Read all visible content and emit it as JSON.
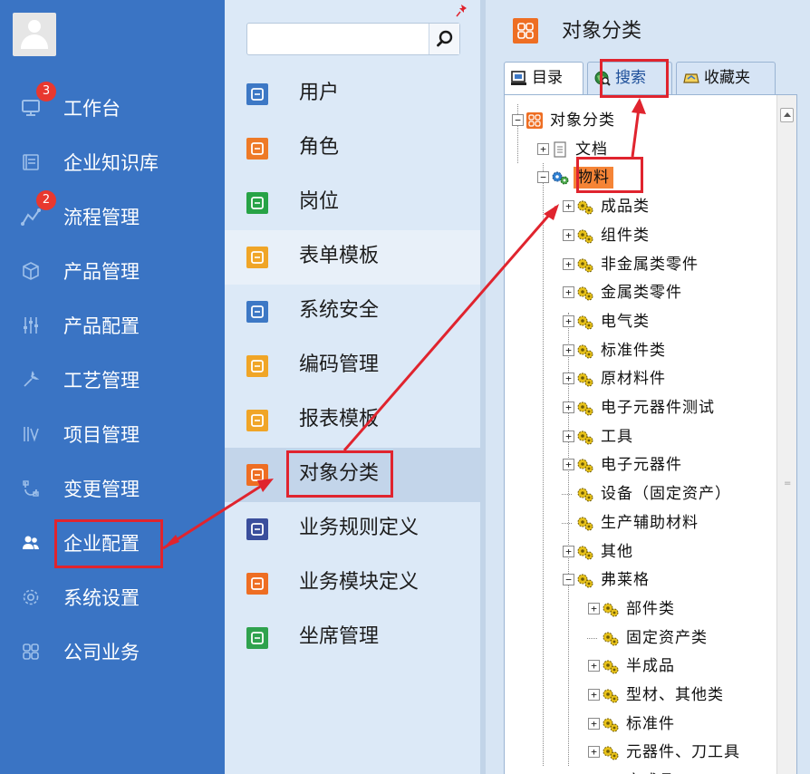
{
  "sidebar": {
    "items": [
      {
        "label": "工作台",
        "icon": "monitor-icon",
        "badge": "3"
      },
      {
        "label": "企业知识库",
        "icon": "book-icon"
      },
      {
        "label": "流程管理",
        "icon": "flow-icon",
        "badge": "2"
      },
      {
        "label": "产品管理",
        "icon": "cube-icon"
      },
      {
        "label": "产品配置",
        "icon": "sliders-icon"
      },
      {
        "label": "工艺管理",
        "icon": "wrench-icon"
      },
      {
        "label": "项目管理",
        "icon": "chart-icon"
      },
      {
        "label": "变更管理",
        "icon": "change-icon"
      },
      {
        "label": "企业配置",
        "icon": "users-icon"
      },
      {
        "label": "系统设置",
        "icon": "gear-icon"
      },
      {
        "label": "公司业务",
        "icon": "grid-icon"
      }
    ]
  },
  "menu": {
    "search": {
      "placeholder": ""
    },
    "items": [
      {
        "label": "用户",
        "icon": "user-icon",
        "color": "#3d78c5"
      },
      {
        "label": "角色",
        "icon": "role-icon",
        "color": "#ee7a27"
      },
      {
        "label": "岗位",
        "icon": "post-icon",
        "color": "#27a346"
      },
      {
        "label": "表单模板",
        "icon": "form-icon",
        "color": "#f0a527"
      },
      {
        "label": "系统安全",
        "icon": "security-icon",
        "color": "#3d78c5"
      },
      {
        "label": "编码管理",
        "icon": "code-icon",
        "color": "#f0a527"
      },
      {
        "label": "报表模板",
        "icon": "report-icon",
        "color": "#f0a527"
      },
      {
        "label": "对象分类",
        "icon": "classify-icon",
        "color": "#ee6e23"
      },
      {
        "label": "业务规则定义",
        "icon": "rule-icon",
        "color": "#3a4e9c"
      },
      {
        "label": "业务模块定义",
        "icon": "module-icon",
        "color": "#ee6e23"
      },
      {
        "label": "坐席管理",
        "icon": "seat-icon",
        "color": "#2fa24e"
      }
    ]
  },
  "panel": {
    "title": "对象分类",
    "tabs": [
      {
        "label": "目录",
        "icon": "catalog-icon"
      },
      {
        "label": "搜索",
        "icon": "globe-search-icon"
      },
      {
        "label": "收藏夹",
        "icon": "favorites-icon"
      }
    ],
    "tree": [
      {
        "label": "对象分类",
        "level": 0,
        "expander": "−",
        "icon": "classify"
      },
      {
        "label": "文档",
        "level": 1,
        "expander": "+",
        "icon": "doc"
      },
      {
        "label": "物料",
        "level": 1,
        "expander": "−",
        "icon": "cog"
      },
      {
        "label": "成品类",
        "level": 2,
        "expander": "+",
        "icon": "cogs"
      },
      {
        "label": "组件类",
        "level": 2,
        "expander": "+",
        "icon": "cogs"
      },
      {
        "label": "非金属类零件",
        "level": 2,
        "expander": "+",
        "icon": "cogs"
      },
      {
        "label": "金属类零件",
        "level": 2,
        "expander": "+",
        "icon": "cogs"
      },
      {
        "label": "电气类",
        "level": 2,
        "expander": "+",
        "icon": "cogs"
      },
      {
        "label": "标准件类",
        "level": 2,
        "expander": "+",
        "icon": "cogs"
      },
      {
        "label": "原材料件",
        "level": 2,
        "expander": "+",
        "icon": "cogs"
      },
      {
        "label": "电子元器件测试",
        "level": 2,
        "expander": "+",
        "icon": "cogs"
      },
      {
        "label": "工具",
        "level": 2,
        "expander": "+",
        "icon": "cogs"
      },
      {
        "label": "电子元器件",
        "level": 2,
        "expander": "+",
        "icon": "cogs"
      },
      {
        "label": "设备（固定资产）",
        "level": 2,
        "expander": "",
        "icon": "cogs"
      },
      {
        "label": "生产辅助材料",
        "level": 2,
        "expander": "",
        "icon": "cogs"
      },
      {
        "label": "其他",
        "level": 2,
        "expander": "+",
        "icon": "cogs"
      },
      {
        "label": "弗莱格",
        "level": 2,
        "expander": "−",
        "icon": "cogs"
      },
      {
        "label": "部件类",
        "level": 3,
        "expander": "+",
        "icon": "cogs"
      },
      {
        "label": "固定资产类",
        "level": 3,
        "expander": "",
        "icon": "cogs"
      },
      {
        "label": "半成品",
        "level": 3,
        "expander": "+",
        "icon": "cogs"
      },
      {
        "label": "型材、其他类",
        "level": 3,
        "expander": "+",
        "icon": "cogs"
      },
      {
        "label": "标准件",
        "level": 3,
        "expander": "+",
        "icon": "cogs"
      },
      {
        "label": "元器件、刀工具",
        "level": 3,
        "expander": "+",
        "icon": "cogs"
      },
      {
        "label": "产成品",
        "level": 3,
        "expander": "+",
        "icon": "cogs"
      }
    ]
  },
  "colors": {
    "sidebar_bg": "#3a74c4",
    "menu_bg": "#dce9f7",
    "annotation_red": "#e0242e",
    "highlight_orange": "#ee6e23"
  }
}
